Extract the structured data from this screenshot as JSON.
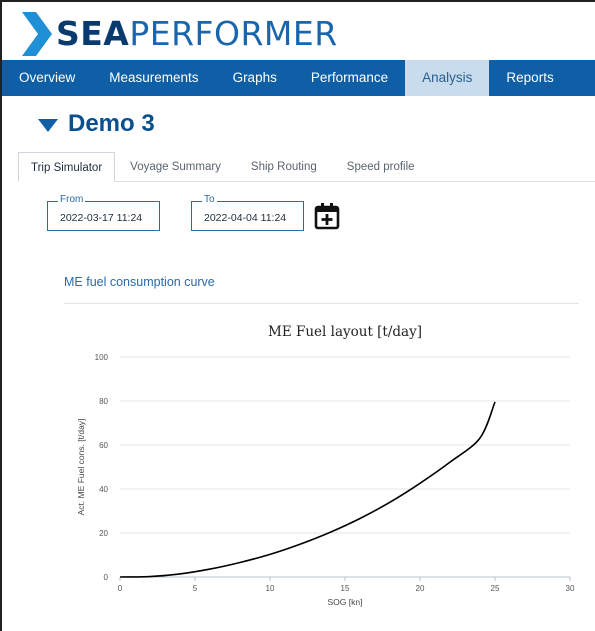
{
  "brand": {
    "name_bold": "SEA",
    "name_thin": "PERFORMER",
    "mark_color": "#1f8fd6"
  },
  "nav": {
    "items": [
      "Overview",
      "Measurements",
      "Graphs",
      "Performance",
      "Analysis",
      "Reports"
    ],
    "active_index": 4,
    "bg_color": "#0e5fa5"
  },
  "page": {
    "title": "Demo 3"
  },
  "tabs": {
    "items": [
      "Trip Simulator",
      "Voyage Summary",
      "Ship Routing",
      "Speed profile"
    ],
    "active_index": 0
  },
  "dates": {
    "from_label": "From",
    "from_value": "2022-03-17 11:24",
    "to_label": "To",
    "to_value": "2022-04-04 11:24",
    "calendar_icon": "calendar-plus-icon"
  },
  "section": {
    "title": "ME fuel consumption curve"
  },
  "chart_data": {
    "type": "line",
    "title": "ME Fuel layout [t/day]",
    "xlabel": "SOG [kn]",
    "ylabel": "Act. ME Fuel cons. [t/day]",
    "xlim": [
      0,
      30
    ],
    "ylim": [
      0,
      100
    ],
    "x_ticks": [
      0,
      5,
      10,
      15,
      20,
      25,
      30
    ],
    "y_ticks": [
      0,
      20,
      40,
      60,
      80,
      100
    ],
    "grid": true,
    "series": [
      {
        "color": "#000000",
        "x": [
          0,
          2,
          4,
          6,
          8,
          10,
          12,
          14,
          16,
          18,
          20,
          22,
          24,
          25
        ],
        "y": [
          0,
          0.2,
          1.4,
          3.6,
          6.6,
          10.3,
          14.9,
          20.3,
          26.6,
          34.0,
          42.6,
          52.2,
          63.2,
          79.6
        ]
      }
    ]
  }
}
